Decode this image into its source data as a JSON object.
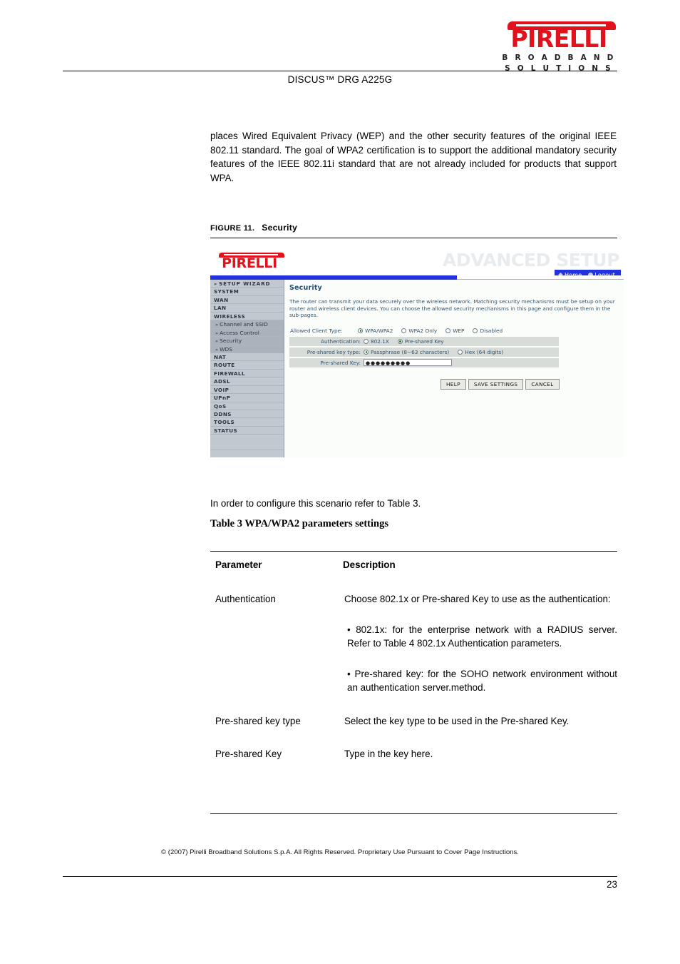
{
  "header": {
    "brand_name": "PIRELLI",
    "brand_tagline_line1": "B R O A D B A N D",
    "brand_tagline_line2": "S O L U T I O N S",
    "document_title": "DISCUS™ DRG A225G",
    "brand_color": "#e1121c"
  },
  "body": {
    "paragraph": "places Wired Equivalent Privacy (WEP) and the other security features of the original IEEE 802.11 standard. The goal of WPA2 certification is to support the additional mandatory security features of the IEEE 802.11i standard that are not already included for products that support WPA."
  },
  "figure": {
    "label": "FIGURE 11.",
    "name": "Security"
  },
  "screenshot": {
    "brand_name": "PIRELLI",
    "advanced_setup": "ADVANCED SETUP",
    "nav": {
      "home": "Home",
      "logout": "Logout"
    },
    "sidebar": [
      {
        "label": "SETUP WIZARD",
        "arrow": "»",
        "type": "wizard"
      },
      {
        "label": "SYSTEM",
        "type": "main"
      },
      {
        "label": "WAN",
        "type": "main"
      },
      {
        "label": "LAN",
        "type": "main"
      },
      {
        "label": "WIRELESS",
        "type": "main"
      },
      {
        "label": "Channel and SSID",
        "arrow": "»",
        "type": "sub"
      },
      {
        "label": "Access Control",
        "arrow": "»",
        "type": "sub"
      },
      {
        "label": "Security",
        "arrow": "»",
        "type": "sub"
      },
      {
        "label": "WDS",
        "arrow": "»",
        "type": "sub"
      },
      {
        "label": "NAT",
        "type": "main"
      },
      {
        "label": "ROUTE",
        "type": "main"
      },
      {
        "label": "FIREWALL",
        "type": "main"
      },
      {
        "label": "ADSL",
        "type": "main"
      },
      {
        "label": "VOIP",
        "type": "main"
      },
      {
        "label": "UPnP",
        "type": "main"
      },
      {
        "label": "QoS",
        "type": "main"
      },
      {
        "label": "DDNS",
        "type": "main"
      },
      {
        "label": "TOOLS",
        "type": "main"
      },
      {
        "label": "STATUS",
        "type": "main"
      }
    ],
    "panel": {
      "title": "Security",
      "description": "The router can transmit your data securely over the wireless network. Matching security mechanisms must be setup on your router and wireless client devices. You can choose the allowed security mechanisms in this page and configure them in the sub-pages.",
      "rows": [
        {
          "label": "Allowed Client Type:",
          "options": [
            {
              "text": "WPA/WPA2",
              "selected": true
            },
            {
              "text": "WPA2 Only",
              "selected": false
            },
            {
              "text": "WEP",
              "selected": false
            },
            {
              "text": "Disabled",
              "selected": false
            }
          ]
        },
        {
          "label": "Authentication:",
          "options": [
            {
              "text": "802.1X",
              "selected": false
            },
            {
              "text": "Pre-shared Key",
              "selected": true
            }
          ]
        },
        {
          "label": "Pre-shared key type:",
          "options": [
            {
              "text": "Passphrase (8~63 characters)",
              "selected": true
            },
            {
              "text": "Hex (64 digits)",
              "selected": false
            }
          ]
        }
      ],
      "key_row": {
        "label": "Pre-shared Key:",
        "value": "●●●●●●●●●"
      },
      "buttons": [
        {
          "label": "HELP"
        },
        {
          "label": "SAVE SETTINGS"
        },
        {
          "label": "CANCEL"
        }
      ]
    }
  },
  "refer_line": "In order to configure this scenario refer to Table 3.",
  "table": {
    "caption": "Table 3 WPA/WPA2 parameters settings",
    "columns": [
      "Parameter",
      "Description"
    ],
    "rows": [
      {
        "parameter": "Authentication",
        "description_parts": [
          " Choose 802.1x or Pre-shared Key to use as the authentication:",
          "• 802.1x: for the enterprise network with a RADIUS server. Refer to Table 4 802.1x Authentication parameters.",
          "• Pre-shared key: for the SOHO network environment without an authentication server.method."
        ]
      },
      {
        "parameter": "Pre-shared key type",
        "description_parts": [
          "Select the key type to be used in the Pre-shared Key."
        ]
      },
      {
        "parameter": "Pre-shared Key",
        "description_parts": [
          "Type in the key here."
        ]
      }
    ]
  },
  "footer": {
    "copyright": "© (2007) Pirelli Broadband Solutions S.p.A. All Rights Reserved. Proprietary Use Pursuant to Cover Page Instructions.",
    "page_number": "23"
  }
}
